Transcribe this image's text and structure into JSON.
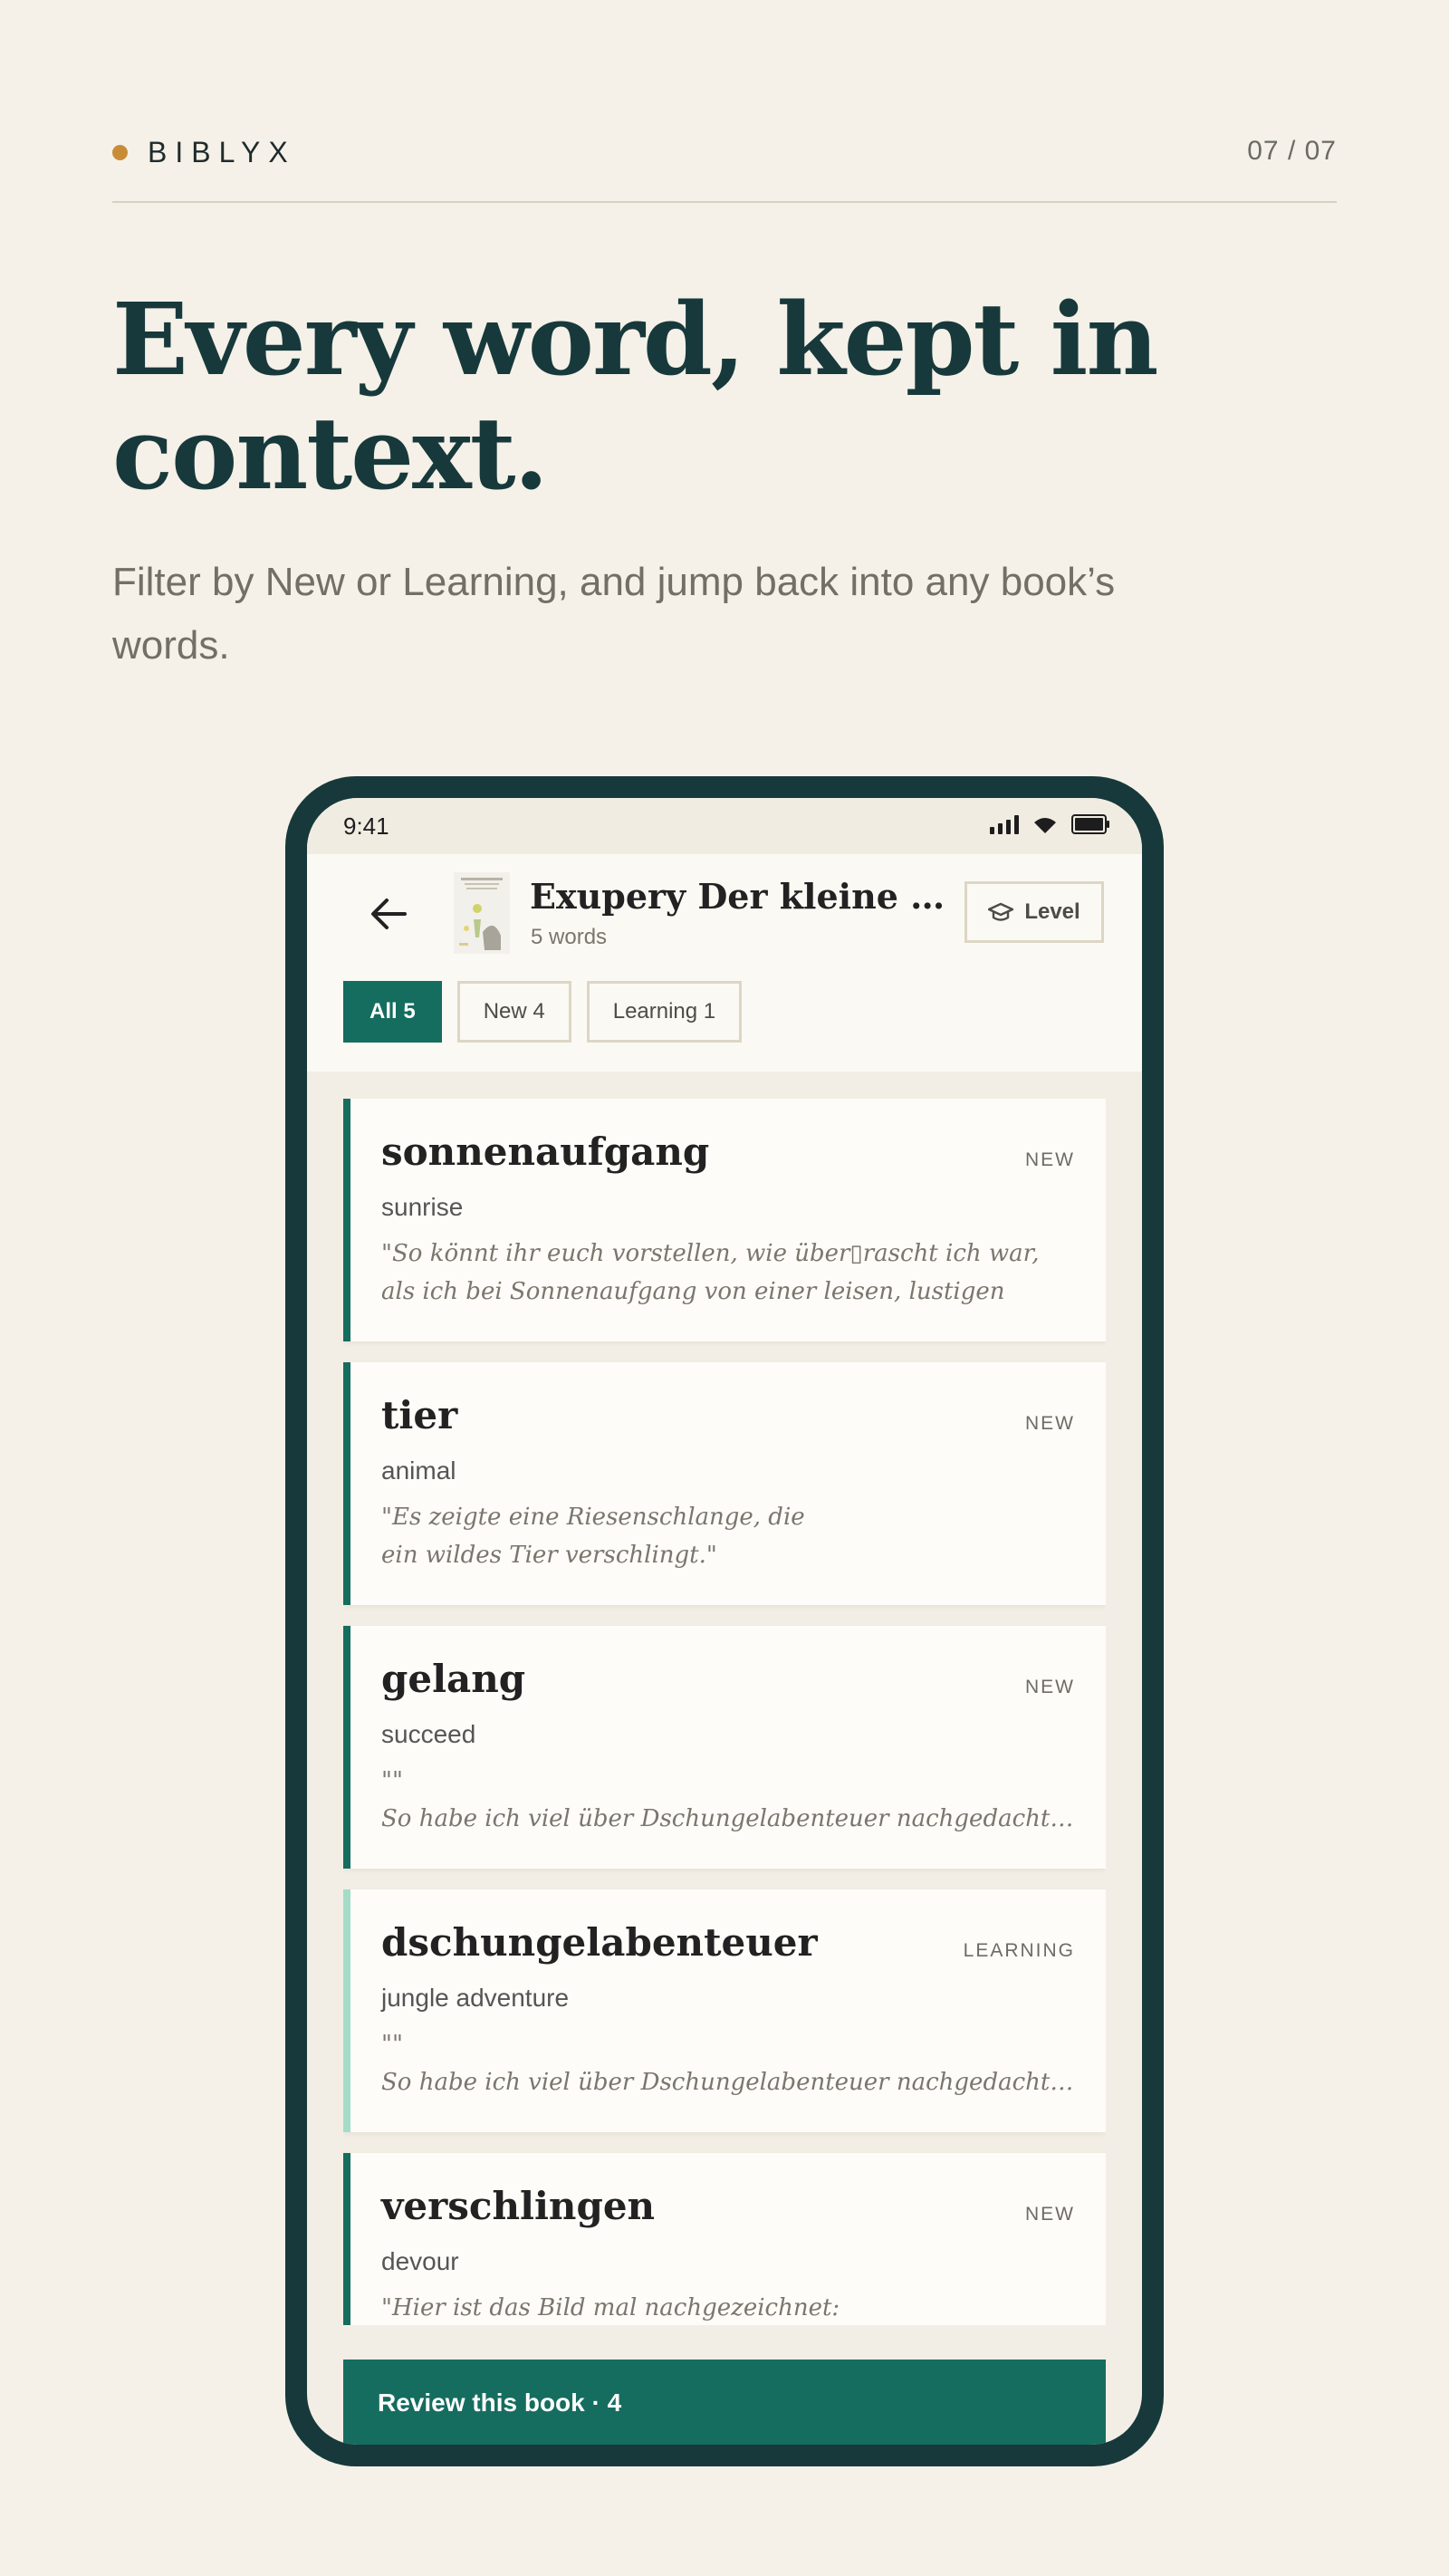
{
  "brand": {
    "name": "BIBLYX",
    "page_indicator": "07 / 07",
    "dot_color": "#c98c36"
  },
  "hero": {
    "headline_line1": "Every word, kept in",
    "headline_line2": "context.",
    "subtitle_line1": "Filter by New or Learning, and jump back into any book’s",
    "subtitle_line2": "words."
  },
  "phone": {
    "status": {
      "time": "9:41"
    },
    "header": {
      "book_title": "Exupery Der kleine Prinz",
      "word_count": "5 words",
      "level_label": "Level"
    },
    "filters": [
      {
        "label": "All 5",
        "active": true
      },
      {
        "label": "New 4",
        "active": false
      },
      {
        "label": "Learning 1",
        "active": false
      }
    ],
    "words": [
      {
        "word": "sonnenaufgang",
        "tag": "NEW",
        "translation": "sunrise",
        "quote_lines": [
          "\"So könnt ihr euch vorstellen, wie über▯rascht ich war,",
          "als ich bei Sonnenaufgang von einer leisen, lustigen"
        ]
      },
      {
        "word": "tier",
        "tag": "NEW",
        "translation": "animal",
        "quote_lines": [
          "\"Es zeigte eine Riesenschlange, die",
          "ein wildes Tier verschlingt.\""
        ]
      },
      {
        "word": "gelang",
        "tag": "NEW",
        "translation": "succeed",
        "quote_lines": [
          "\"\"",
          "So habe ich viel über Dschungelabenteuer nachgedacht und"
        ]
      },
      {
        "word": "dschungelabenteuer",
        "tag": "LEARNING",
        "translation": "jungle adventure",
        "quote_lines": [
          "\"\"",
          "So habe ich viel über Dschungelabenteuer nachgedacht und"
        ]
      },
      {
        "word": "verschlingen",
        "tag": "NEW",
        "translation": "devour",
        "quote_lines": [
          "\"Hier ist das Bild mal nachgezeichnet:",
          ""
        ]
      }
    ],
    "review_button": "Review this book · 4"
  },
  "colors": {
    "accent": "#156d5f",
    "learning": "#a4dcca",
    "frame": "#17393b",
    "background": "#f5f1e8"
  }
}
